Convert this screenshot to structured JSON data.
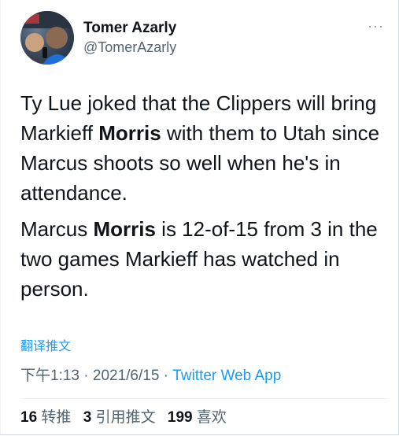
{
  "author": {
    "display_name": "Tomer Azarly",
    "handle": "@TomerAzarly"
  },
  "menu": {
    "more_label": "···"
  },
  "tweet": {
    "p1_before": "Ty Lue joked that the Clippers will bring Markieff ",
    "p1_bold": "Morris",
    "p1_after": " with them to Utah since Marcus shoots so well when he's in attendance.",
    "p2_before": "Marcus ",
    "p2_bold": "Morris",
    "p2_after": " is 12-of-15 from 3 in the two games Markieff has watched in person."
  },
  "translate_label": "翻译推文",
  "meta": {
    "time": "下午1:13",
    "sep1": " · ",
    "date": "2021/6/15",
    "sep2": " · ",
    "source": "Twitter Web App"
  },
  "stats": {
    "retweets_count": "16",
    "retweets_label": "转推",
    "quotes_count": "3",
    "quotes_label": "引用推文",
    "likes_count": "199",
    "likes_label": "喜欢"
  },
  "colors": {
    "link": "#1d9bf0",
    "text": "#0f1419",
    "secondary": "#536471",
    "background": "#ffffff"
  }
}
